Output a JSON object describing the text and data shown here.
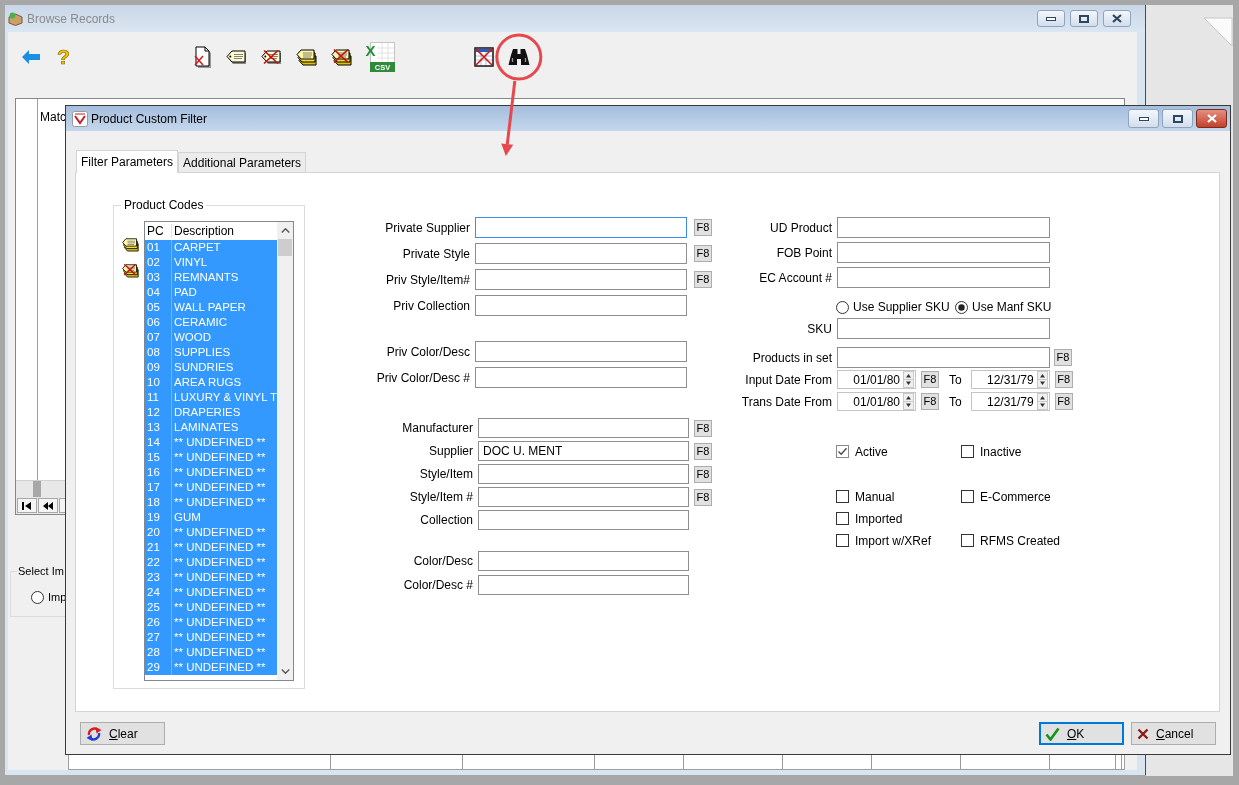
{
  "browse_window": {
    "title": "Browse Records",
    "active": false,
    "window_buttons": [
      {
        "kind": "minimize"
      },
      {
        "kind": "maximize"
      },
      {
        "kind": "close"
      }
    ],
    "toolbar": [
      {
        "items": [
          {
            "kind": "back",
            "highlighted": false
          },
          {
            "kind": "help",
            "glyph": "?",
            "highlighted": false
          }
        ]
      },
      {
        "items": [
          {
            "kind": "delete_document",
            "highlighted": false
          },
          {
            "kind": "tag",
            "highlighted": false
          },
          {
            "kind": "tag_delete",
            "highlighted": false
          },
          {
            "kind": "tags",
            "highlighted": false
          },
          {
            "kind": "tags_delete",
            "highlighted": false
          },
          {
            "kind": "csv",
            "mark": "X",
            "text": "CSV",
            "highlighted": false
          }
        ]
      },
      {
        "items": [
          {
            "kind": "grid_delete",
            "highlighted": false
          },
          {
            "kind": "find",
            "highlighted": true
          }
        ]
      }
    ],
    "grid": {
      "columns": [
        "Matc"
      ]
    },
    "nav_buttons": [
      {
        "kind": "first"
      },
      {
        "kind": "rewind"
      },
      {
        "kind": "previous"
      }
    ],
    "select_group": {
      "title": "Select Im",
      "options": [
        {
          "label": "Imp",
          "selected": false
        }
      ]
    }
  },
  "dialog": {
    "title": "Product Custom Filter",
    "active": true,
    "window_buttons": [
      {
        "kind": "minimize"
      },
      {
        "kind": "maximize"
      },
      {
        "kind": "close"
      }
    ],
    "tabs": [
      {
        "label": "Filter Parameters",
        "selected": true
      },
      {
        "label": "Additional Parameters",
        "selected": false
      }
    ],
    "product_codes": {
      "title": "Product Codes",
      "tools": [
        {
          "kind": "tags"
        },
        {
          "kind": "tags_delete"
        }
      ],
      "columns": [
        "PC",
        "Description"
      ],
      "rows": [
        {
          "code": "01",
          "description": "CARPET",
          "selected": true
        },
        {
          "code": "02",
          "description": "VINYL",
          "selected": true
        },
        {
          "code": "03",
          "description": "REMNANTS",
          "selected": true
        },
        {
          "code": "04",
          "description": "PAD",
          "selected": true
        },
        {
          "code": "05",
          "description": "WALL PAPER",
          "selected": true
        },
        {
          "code": "06",
          "description": "CERAMIC",
          "selected": true
        },
        {
          "code": "07",
          "description": "WOOD",
          "selected": true
        },
        {
          "code": "08",
          "description": "SUPPLIES",
          "selected": true
        },
        {
          "code": "09",
          "description": "SUNDRIES",
          "selected": true
        },
        {
          "code": "10",
          "description": "AREA RUGS",
          "selected": true
        },
        {
          "code": "11",
          "description": "LUXURY & VINYL T",
          "selected": true
        },
        {
          "code": "12",
          "description": "DRAPERIES",
          "selected": true
        },
        {
          "code": "13",
          "description": "LAMINATES",
          "selected": true
        },
        {
          "code": "14",
          "description": "** UNDEFINED **",
          "selected": true
        },
        {
          "code": "15",
          "description": "** UNDEFINED **",
          "selected": true
        },
        {
          "code": "16",
          "description": "** UNDEFINED **",
          "selected": true
        },
        {
          "code": "17",
          "description": "** UNDEFINED **",
          "selected": true
        },
        {
          "code": "18",
          "description": "** UNDEFINED **",
          "selected": true
        },
        {
          "code": "19",
          "description": "GUM",
          "selected": true
        },
        {
          "code": "20",
          "description": "** UNDEFINED **",
          "selected": true
        },
        {
          "code": "21",
          "description": "** UNDEFINED **",
          "selected": true
        },
        {
          "code": "22",
          "description": "** UNDEFINED **",
          "selected": true
        },
        {
          "code": "23",
          "description": "** UNDEFINED **",
          "selected": true
        },
        {
          "code": "24",
          "description": "** UNDEFINED **",
          "selected": true
        },
        {
          "code": "25",
          "description": "** UNDEFINED **",
          "selected": true
        },
        {
          "code": "26",
          "description": "** UNDEFINED **",
          "selected": true
        },
        {
          "code": "27",
          "description": "** UNDEFINED **",
          "selected": true
        },
        {
          "code": "28",
          "description": "** UNDEFINED **",
          "selected": true
        },
        {
          "code": "29",
          "description": "** UNDEFINED **",
          "selected": true
        }
      ]
    },
    "field_groups": [
      {
        "fields": [
          {
            "label": "Private Supplier",
            "focused": true,
            "button": "F8"
          },
          {
            "label": "Private Style",
            "focused": false,
            "button": "F8"
          },
          {
            "label": "Priv Style/Item#",
            "focused": false,
            "button": "F8"
          },
          {
            "label": "Priv Collection",
            "focused": false
          }
        ]
      },
      {
        "fields": [
          {
            "label": "Priv Color/Desc",
            "focused": false
          },
          {
            "label": "Priv Color/Desc #",
            "focused": false
          }
        ]
      },
      {
        "fields": [
          {
            "label": "Manufacturer",
            "focused": false,
            "button": "F8"
          },
          {
            "label": "Supplier",
            "value": "DOC U. MENT",
            "focused": false,
            "button": "F8"
          },
          {
            "label": "Style/Item",
            "focused": false,
            "button": "F8"
          },
          {
            "label": "Style/Item #",
            "focused": false,
            "button": "F8"
          },
          {
            "label": "Collection",
            "focused": false
          }
        ]
      },
      {
        "fields": [
          {
            "label": "Color/Desc",
            "focused": false
          },
          {
            "label": "Color/Desc #",
            "focused": false
          }
        ]
      }
    ],
    "right_column": [
      {
        "kind": "text",
        "label": "UD Product"
      },
      {
        "kind": "text",
        "label": "FOB Point"
      },
      {
        "kind": "text",
        "label": "EC Account #"
      },
      {
        "kind": "radios",
        "options": [
          {
            "label": "Use Supplier SKU",
            "selected": false
          },
          {
            "label": "Use Manf SKU",
            "selected": true
          }
        ]
      },
      {
        "kind": "text",
        "label": "SKU"
      },
      {
        "kind": "text",
        "label": "Products in set",
        "button": "F8"
      },
      {
        "kind": "date_range",
        "label": "Input Date From",
        "from": "01/01/80",
        "from_button": "F8",
        "to_label": "To",
        "to": "12/31/79",
        "to_button": "F8"
      },
      {
        "kind": "date_range",
        "label": "Trans Date From",
        "from": "01/01/80",
        "from_button": "F8",
        "to_label": "To",
        "to": "12/31/79",
        "to_button": "F8"
      },
      {
        "kind": "checks",
        "rows": [
          [
            {
              "label": "Active",
              "checked": true
            },
            {
              "label": "Inactive",
              "checked": false
            }
          ]
        ]
      },
      {
        "kind": "checks",
        "rows": [
          [
            {
              "label": "Manual",
              "checked": false
            },
            {
              "label": "E-Commerce",
              "checked": false
            }
          ],
          [
            {
              "label": "Imported",
              "checked": false
            }
          ],
          [
            {
              "label": "Import w/XRef",
              "checked": false
            },
            {
              "label": "RFMS Created",
              "checked": false
            }
          ]
        ]
      }
    ],
    "footer": {
      "left": [
        {
          "kind": "clear",
          "label": "Clear",
          "default": false
        }
      ],
      "right": [
        {
          "kind": "ok",
          "label": "OK",
          "default": true
        },
        {
          "kind": "cancel",
          "label": "Cancel",
          "default": false
        }
      ]
    }
  }
}
